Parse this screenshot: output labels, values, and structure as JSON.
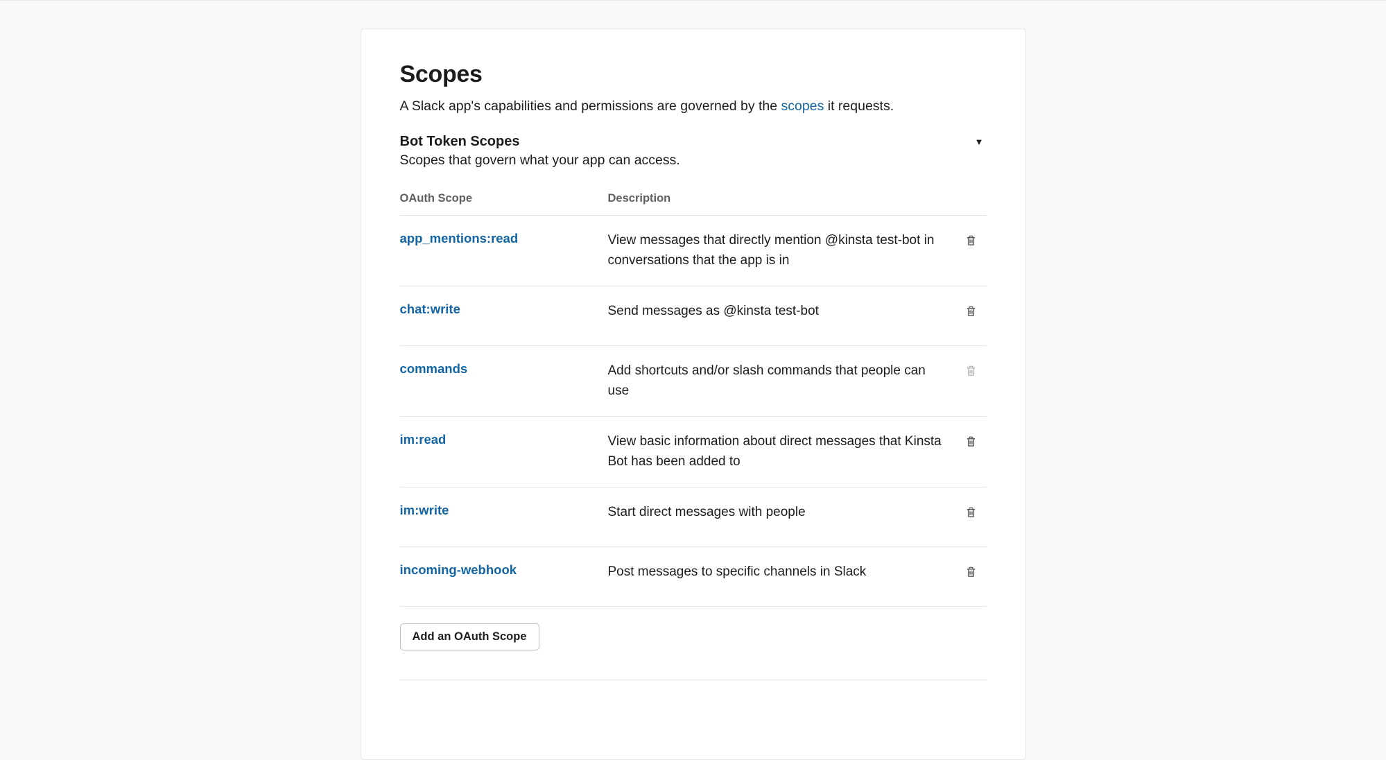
{
  "heading": "Scopes",
  "intro_pre": "A Slack app's capabilities and permissions are governed by the ",
  "intro_link": "scopes",
  "intro_post": " it requests.",
  "subsection": {
    "title": "Bot Token Scopes",
    "desc": "Scopes that govern what your app can access."
  },
  "table": {
    "header_scope": "OAuth Scope",
    "header_desc": "Description"
  },
  "scopes": [
    {
      "name": "app_mentions:read",
      "desc": "View messages that directly mention @kinsta test-bot in conversations that the app is in",
      "disabled": false
    },
    {
      "name": "chat:write",
      "desc": "Send messages as @kinsta test-bot",
      "disabled": false
    },
    {
      "name": "commands",
      "desc": "Add shortcuts and/or slash commands that people can use",
      "disabled": true
    },
    {
      "name": "im:read",
      "desc": "View basic information about direct messages that Kinsta Bot has been added to",
      "disabled": false
    },
    {
      "name": "im:write",
      "desc": "Start direct messages with people",
      "disabled": false
    },
    {
      "name": "incoming-webhook",
      "desc": "Post messages to specific channels in Slack",
      "disabled": false
    }
  ],
  "add_button": "Add an OAuth Scope"
}
